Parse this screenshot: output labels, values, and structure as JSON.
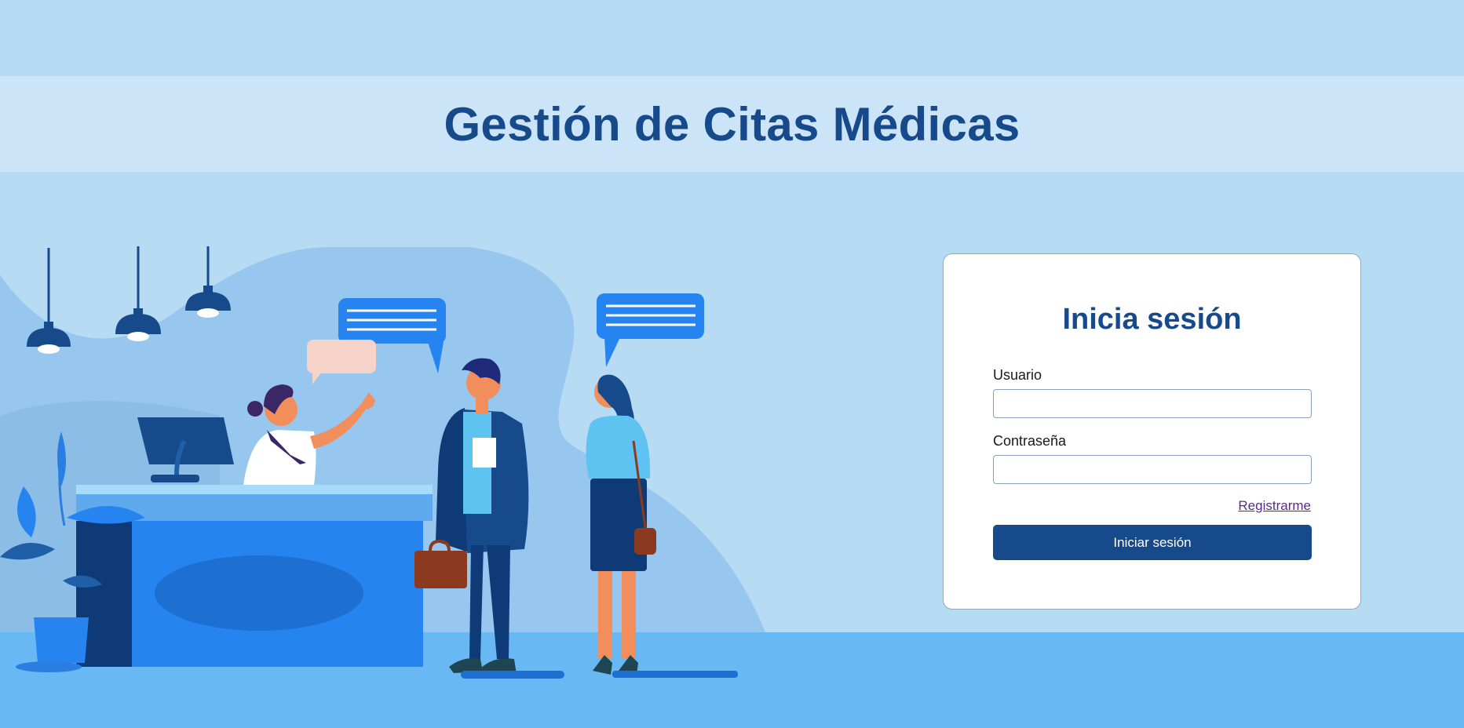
{
  "header": {
    "title": "Gestión de Citas Médicas"
  },
  "login": {
    "heading": "Inicia sesión",
    "username_label": "Usuario",
    "username_value": "",
    "password_label": "Contraseña",
    "password_value": "",
    "register_link": "Registrarme",
    "submit_label": "Iniciar sesión"
  },
  "illustration": {
    "subject": "reception-desk-scene",
    "colors": {
      "background": "#b8dbf4",
      "floor": "#68b8f3",
      "accent": "#174a8b",
      "desk": "#2684f0"
    }
  }
}
